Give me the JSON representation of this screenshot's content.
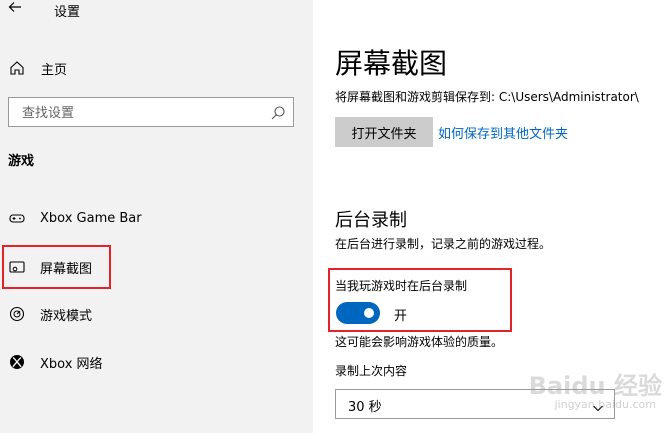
{
  "window": {
    "title": "设置"
  },
  "sidebar": {
    "home_label": "主页",
    "search": {
      "placeholder": "查找设置",
      "value": ""
    },
    "section": "游戏",
    "items": [
      {
        "label": "Xbox Game Bar",
        "icon": "gamebar-icon"
      },
      {
        "label": "屏幕截图",
        "icon": "capture-icon"
      },
      {
        "label": "游戏模式",
        "icon": "game-mode-icon"
      },
      {
        "label": "Xbox 网络",
        "icon": "xbox-icon"
      }
    ]
  },
  "main": {
    "title": "屏幕截图",
    "save_path": "将屏幕截图和游戏剪辑保存到: C:\\Users\\Administrator\\",
    "open_folder_label": "打开文件夹",
    "change_location_link": "如何保存到其他文件夹",
    "background": {
      "title": "后台录制",
      "description": "在后台进行录制，记录之前的游戏过程。",
      "toggle_label": "当我玩游戏时在后台录制",
      "toggle_state": "开",
      "toggle_on": true,
      "note": "这可能会影响游戏体验的质量。",
      "record_last_label": "录制上次内容",
      "record_last_value": "30 秒"
    }
  },
  "colors": {
    "accent": "#0067c0",
    "highlight": "#e0242a",
    "sidebar_bg": "#f2f2f2"
  },
  "watermark": {
    "text": "Baidu 经验",
    "sub": "jingyan.baidu.com"
  }
}
